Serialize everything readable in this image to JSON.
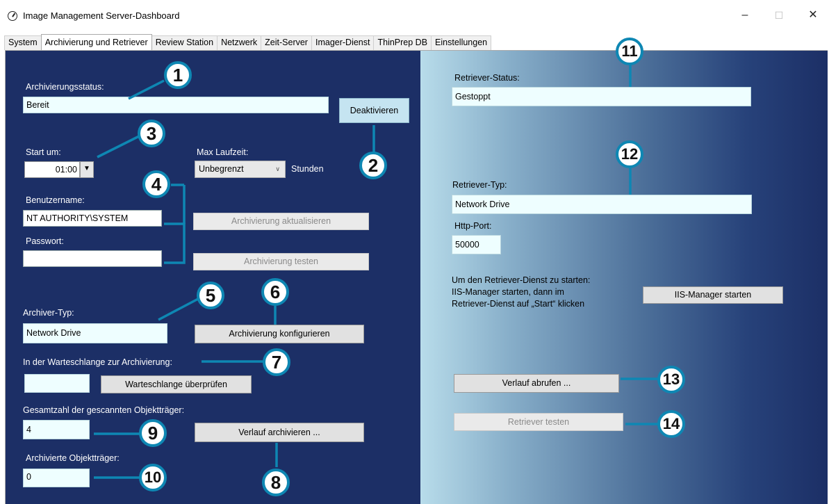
{
  "window": {
    "title": "Image Management Server-Dashboard",
    "minimize": "–",
    "maximize": "☐",
    "close": "✕"
  },
  "tabs": [
    "System",
    "Archivierung und Retriever",
    "Review Station",
    "Netzwerk",
    "Zeit-Server",
    "Imager-Dienst",
    "ThinPrep DB",
    "Einstellungen"
  ],
  "archive": {
    "status_label": "Archivierungsstatus:",
    "status_value": "Bereit",
    "deactivate_button": "Deaktivieren",
    "start_label": "Start um:",
    "start_value": "01:00",
    "max_runtime_label": "Max Laufzeit:",
    "max_runtime_value": "Unbegrenzt",
    "hours_label": "Stunden",
    "username_label": "Benutzername:",
    "username_value": "NT AUTHORITY\\SYSTEM",
    "password_label": "Passwort:",
    "password_value": "",
    "update_button": "Archivierung aktualisieren",
    "test_button": "Archivierung testen",
    "archiver_type_label": "Archiver-Typ:",
    "archiver_type_value": "Network Drive",
    "configure_button": "Archivierung konfigurieren",
    "queue_label": "In der Warteschlange zur Archivierung:",
    "queue_value": "",
    "queue_check_button": "Warteschlange überprüfen",
    "total_scanned_label": "Gesamtzahl der gescannten Objektträger:",
    "total_scanned_value": "4",
    "archive_history_button": "Verlauf archivieren ...",
    "archived_label": "Archivierte Objektträger:",
    "archived_value": "0"
  },
  "retriever": {
    "status_label": "Retriever-Status:",
    "status_value": "Gestoppt",
    "type_label": "Retriever-Typ:",
    "type_value": "Network Drive",
    "http_port_label": "Http-Port:",
    "http_port_value": "50000",
    "instructions_line1": "Um den Retriever-Dienst zu starten:",
    "instructions_line2": "IIS-Manager starten, dann im",
    "instructions_line3": "Retriever-Dienst auf „Start“ klicken",
    "iis_button": "IIS-Manager starten",
    "history_button": "Verlauf abrufen ...",
    "test_button": "Retriever testen"
  },
  "callouts": [
    "1",
    "2",
    "3",
    "4",
    "5",
    "6",
    "7",
    "8",
    "9",
    "10",
    "11",
    "12",
    "13",
    "14"
  ],
  "colors": {
    "left_panel": "#1c2f66",
    "callout_border": "#0e87b3",
    "field_bg": "#eefeff"
  }
}
